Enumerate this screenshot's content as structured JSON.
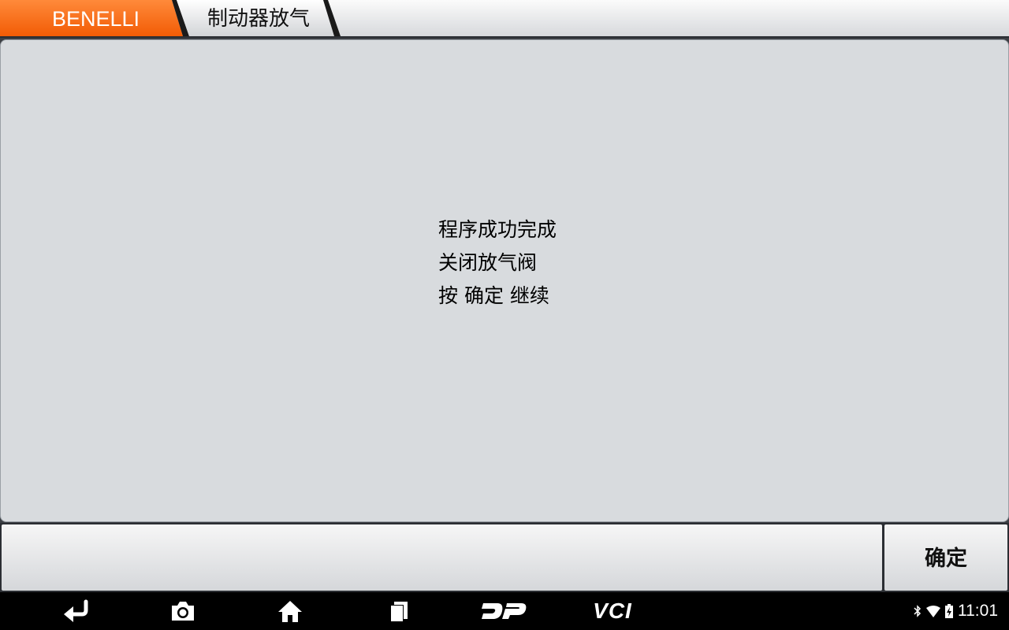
{
  "breadcrumb": {
    "brand": "BENELLI",
    "page": "制动器放气",
    "brand_color": "#ff6a13"
  },
  "message": {
    "lines": [
      "程序成功完成",
      "关闭放气阀",
      "按 确定 继续"
    ]
  },
  "footer": {
    "confirm_label": "确定"
  },
  "nav": {
    "icons": [
      "back-icon",
      "camera-icon",
      "home-icon",
      "recent-apps-icon",
      "dp-logo-icon",
      "vci-icon"
    ],
    "vci_label": "VCI"
  },
  "status": {
    "time": "11:01",
    "icons": [
      "bluetooth-icon",
      "wifi-icon",
      "battery-icon"
    ]
  }
}
